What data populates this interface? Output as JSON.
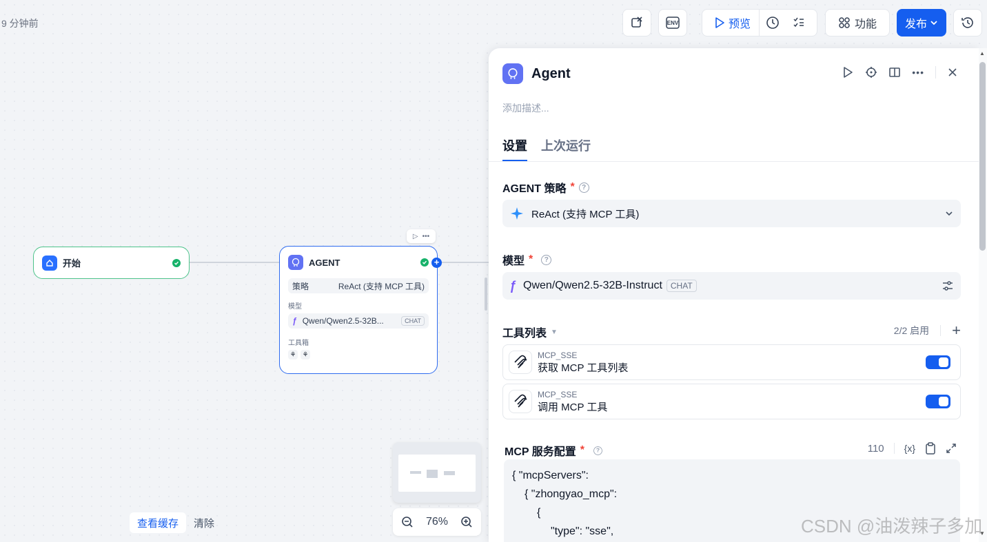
{
  "header": {
    "saved_time": "9 分钟前",
    "preview_label": "预览",
    "func_label": "功能",
    "publish_label": "发布",
    "env_label": "ENV"
  },
  "canvas": {
    "start_node": {
      "title": "开始"
    },
    "agent_node": {
      "title": "AGENT",
      "strategy_label": "策略",
      "strategy_value": "ReAct (支持 MCP 工具)",
      "model_label": "模型",
      "model_value": "Qwen/Qwen2.5-32B...",
      "model_badge": "CHAT",
      "toolbox_label": "工具箱"
    },
    "cache_btn": "查看缓存",
    "clear_btn": "清除",
    "zoom_level": "76%"
  },
  "panel": {
    "title": "Agent",
    "description_placeholder": "添加描述...",
    "tabs": [
      {
        "label": "设置",
        "active": true
      },
      {
        "label": "上次运行",
        "active": false
      }
    ],
    "strategy": {
      "label": "AGENT 策略",
      "required": "*",
      "value": "ReAct (支持 MCP 工具)"
    },
    "model": {
      "label": "模型",
      "required": "*",
      "value": "Qwen/Qwen2.5-32B-Instruct",
      "badge": "CHAT"
    },
    "tools": {
      "label": "工具列表",
      "count": "2/2 启用",
      "items": [
        {
          "provider": "MCP_SSE",
          "name": "获取 MCP 工具列表",
          "enabled": true
        },
        {
          "provider": "MCP_SSE",
          "name": "调用 MCP 工具",
          "enabled": true
        }
      ]
    },
    "mcp_config": {
      "label": "MCP 服务配置",
      "required": "*",
      "char_count": "110",
      "var_label": "{x}",
      "code_lines": [
        "{ \"mcpServers\":",
        "{ \"zhongyao_mcp\":",
        "{",
        "\"type\": \"sse\","
      ]
    }
  },
  "watermark": "CSDN @油泼辣子多加",
  "colors": {
    "accent": "#155eef",
    "success": "#17b26a",
    "agent": "#6172f3"
  }
}
